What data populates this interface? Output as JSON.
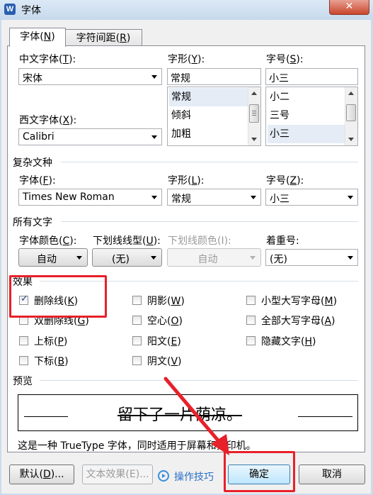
{
  "window": {
    "title": "字体",
    "app_icon": "W",
    "close_glyph": "✕"
  },
  "tabs": [
    {
      "label": "字体(",
      "key": "N",
      "suffix": ")"
    },
    {
      "label": "字符间距(",
      "key": "R",
      "suffix": ")"
    }
  ],
  "chinese_font": {
    "label": "中文字体(",
    "key": "T",
    "suffix": "):",
    "value": "宋体"
  },
  "western_font": {
    "label": "西文字体(",
    "key": "X",
    "suffix": "):",
    "value": "Calibri"
  },
  "style": {
    "label": "字形(",
    "key": "Y",
    "suffix": "):",
    "value": "常规",
    "options": [
      "常规",
      "倾斜",
      "加粗"
    ],
    "selected_index": 0
  },
  "size": {
    "label": "字号(",
    "key": "S",
    "suffix": "):",
    "value": "小三",
    "options": [
      "小二",
      "三号",
      "小三"
    ],
    "selected_index": 2
  },
  "complex": {
    "section": "复杂文种",
    "font_label": "字体(",
    "font_key": "F",
    "font_suffix": "):",
    "font_value": "Times New Roman",
    "style_label": "字形(",
    "style_key": "L",
    "style_suffix": "):",
    "style_value": "常规",
    "size_label": "字号(",
    "size_key": "Z",
    "size_suffix": "):",
    "size_value": "小三"
  },
  "all_text": {
    "section": "所有文字",
    "color_label": "字体颜色(",
    "color_key": "C",
    "color_suffix": "):",
    "color_value": "自动",
    "underline_label": "下划线线型(",
    "underline_key": "U",
    "underline_suffix": "):",
    "underline_value": "(无)",
    "underline_color_label": "下划线颜色(I):",
    "underline_color_value": "自动",
    "emphasis_label": "着重号:",
    "emphasis_value": "(无)"
  },
  "effects": {
    "section": "效果",
    "items": [
      {
        "label": "删除线(",
        "key": "K",
        "suffix": ")",
        "checked": true
      },
      {
        "label": "双删除线(",
        "key": "G",
        "suffix": ")",
        "checked": false
      },
      {
        "label": "上标(",
        "key": "P",
        "suffix": ")",
        "checked": false
      },
      {
        "label": "下标(",
        "key": "B",
        "suffix": ")",
        "checked": false
      },
      {
        "label": "阴影(",
        "key": "W",
        "suffix": ")",
        "checked": false
      },
      {
        "label": "空心(",
        "key": "O",
        "suffix": ")",
        "checked": false
      },
      {
        "label": "阳文(",
        "key": "E",
        "suffix": ")",
        "checked": false
      },
      {
        "label": "阴文(",
        "key": "V",
        "suffix": ")",
        "checked": false
      },
      {
        "label": "小型大写字母(",
        "key": "M",
        "suffix": ")",
        "checked": false
      },
      {
        "label": "全部大写字母(",
        "key": "A",
        "suffix": ")",
        "checked": false
      },
      {
        "label": "隐藏文字(",
        "key": "H",
        "suffix": ")",
        "checked": false
      }
    ]
  },
  "preview": {
    "section": "预览",
    "sample": "留下了一片荫凉。",
    "note": "这是一种 TrueType 字体，同时适用于屏幕和打印机。"
  },
  "buttons": {
    "default_label": "默认(",
    "default_key": "D",
    "default_suffix": ")...",
    "text_effects": "文本效果(E)...",
    "tips": "操作技巧",
    "ok": "确定",
    "cancel": "取消"
  },
  "colors": {
    "highlight": "#e8202a",
    "link": "#2a6fc9"
  }
}
